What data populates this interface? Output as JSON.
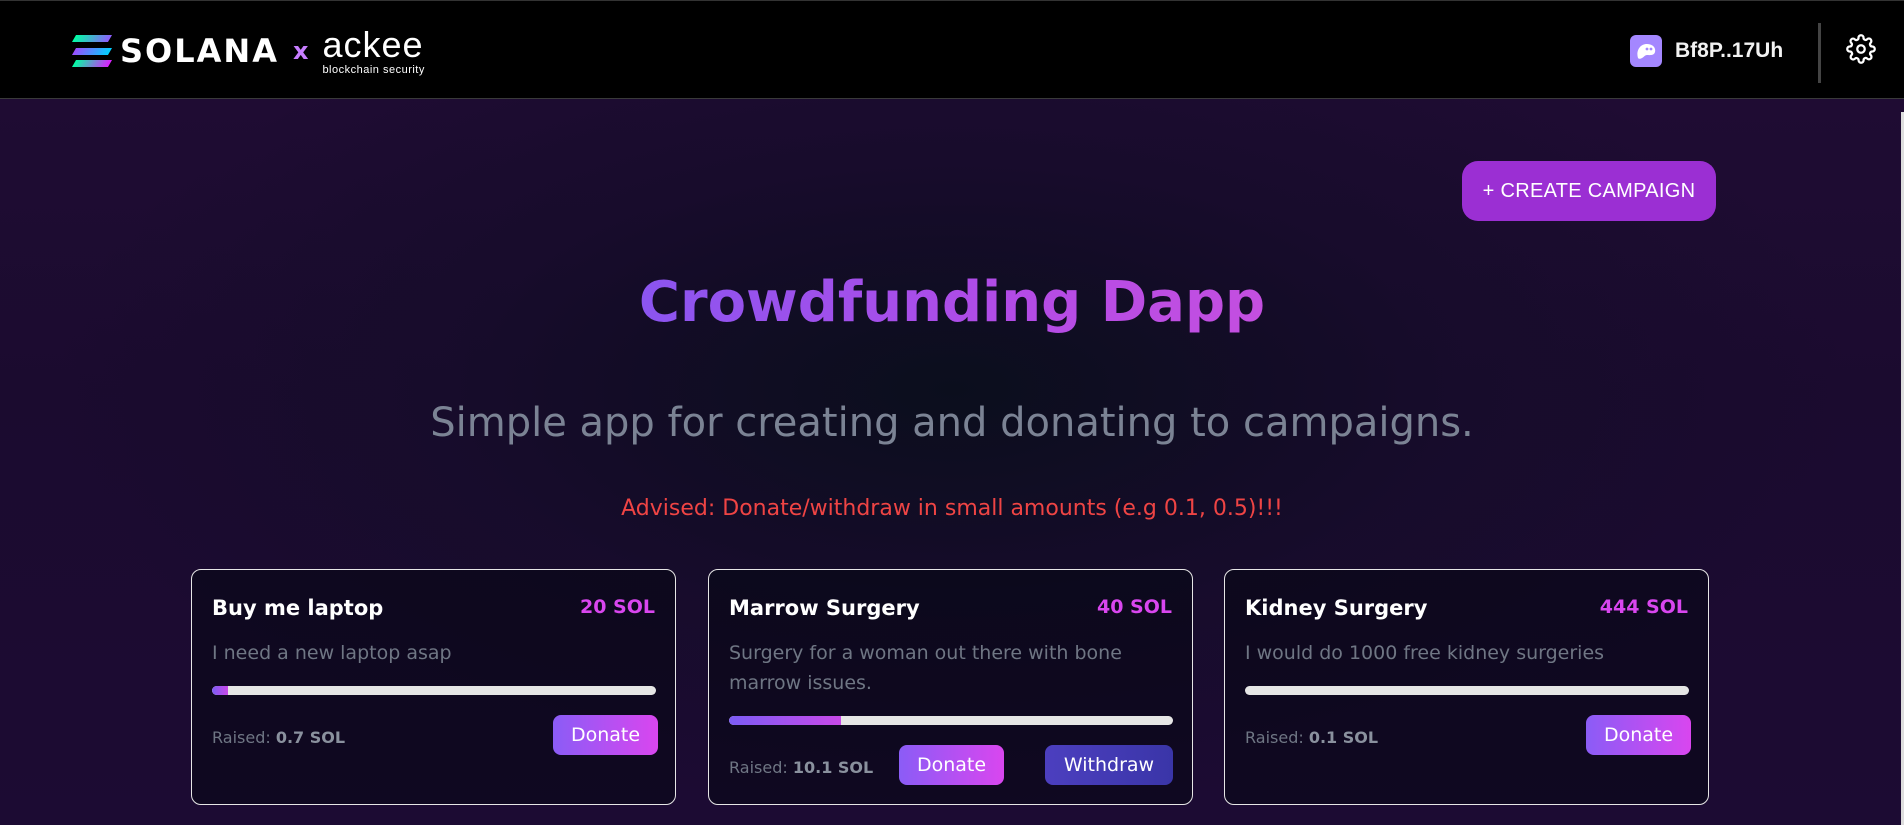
{
  "header": {
    "brand_left": "SOLANA",
    "brand_x": "x",
    "brand_right": "ackee",
    "brand_right_sub": "blockchain security",
    "wallet_address": "Bf8P..17Uh"
  },
  "actions": {
    "create_campaign_label": "+ CREATE CAMPAIGN"
  },
  "hero": {
    "title": "Crowdfunding Dapp",
    "subtitle": "Simple app for creating and donating to campaigns.",
    "advisory": "Advised: Donate/withdraw in small amounts (e.g 0.1, 0.5)!!!"
  },
  "campaigns": [
    {
      "name": "Buy me laptop",
      "goal": "20 SOL",
      "description": "I need a new laptop asap",
      "raised_label": "Raised:",
      "raised_value": "0.7 SOL",
      "progress_fraction": 0.035,
      "donate_label": "Donate"
    },
    {
      "name": "Marrow Surgery",
      "goal": "40 SOL",
      "description": "Surgery for a woman out there with bone marrow issues.",
      "raised_label": "Raised:",
      "raised_value": "10.1 SOL",
      "progress_fraction": 0.2525,
      "donate_label": "Donate",
      "withdraw_label": "Withdraw"
    },
    {
      "name": "Kidney Surgery",
      "goal": "444 SOL",
      "description": "I would do 1000 free kidney surgeries",
      "raised_label": "Raised:",
      "raised_value": "0.1 SOL",
      "progress_fraction": 0.0002,
      "donate_label": "Donate"
    }
  ],
  "colors": {
    "accent_purple": "#9b2fd3",
    "goal_magenta": "#d946ef",
    "advisory_red": "#ef4444",
    "subtitle_gray": "#7b8394"
  },
  "icons": {
    "solana_logo": "solana-logo",
    "wallet": "ghost-wallet-icon",
    "settings": "gear-icon"
  }
}
